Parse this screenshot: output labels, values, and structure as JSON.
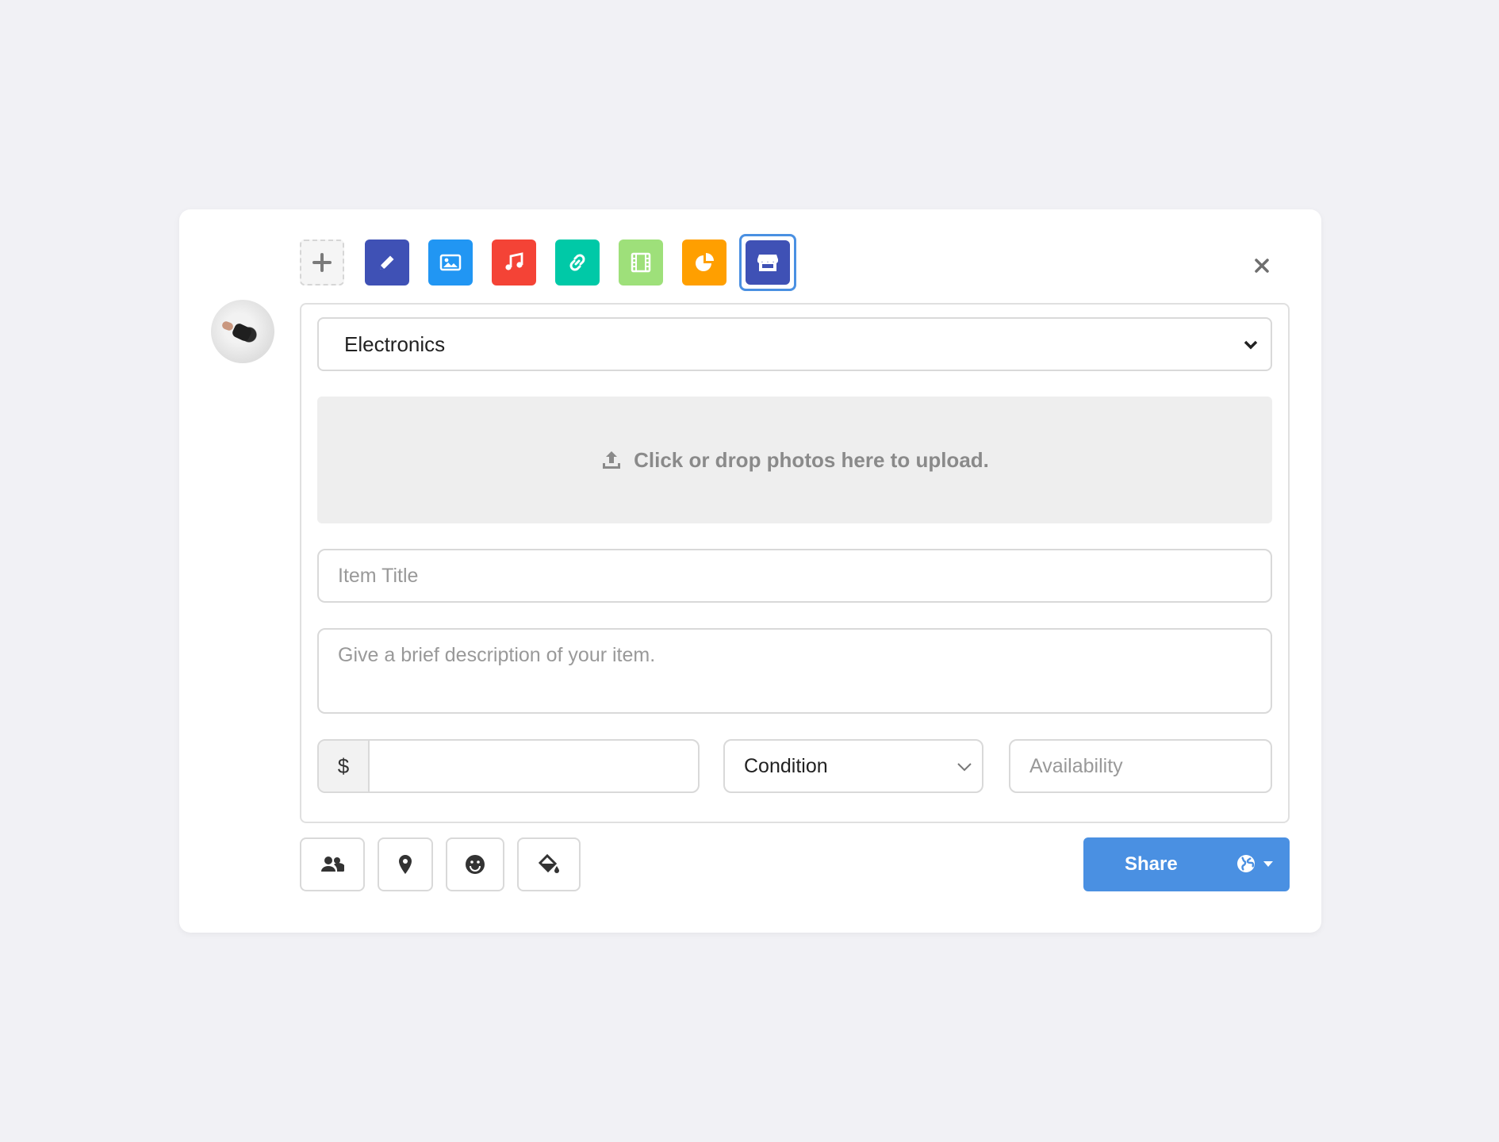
{
  "post_types": [
    {
      "name": "add",
      "color": "#f5f5f5",
      "icon": "plus-icon"
    },
    {
      "name": "text",
      "color": "#3f51b5",
      "icon": "pencil-icon"
    },
    {
      "name": "photo",
      "color": "#2196f3",
      "icon": "image-icon"
    },
    {
      "name": "music",
      "color": "#f44336",
      "icon": "music-note-icon"
    },
    {
      "name": "link",
      "color": "#00c9a7",
      "icon": "link-icon"
    },
    {
      "name": "video",
      "color": "#9ee07a",
      "icon": "film-icon"
    },
    {
      "name": "poll",
      "color": "#ff9f00",
      "icon": "pie-chart-icon"
    },
    {
      "name": "sell",
      "color": "#3f51b5",
      "icon": "store-icon",
      "selected": true
    }
  ],
  "form": {
    "category": "Electronics",
    "upload_text": "Click or drop photos here to upload.",
    "title_placeholder": "Item Title",
    "description_placeholder": "Give a brief description of your item.",
    "currency_symbol": "$",
    "price_value": "",
    "condition_label": "Condition",
    "availability_placeholder": "Availability"
  },
  "toolbar": {
    "icons": [
      "users-icon",
      "location-pin-icon",
      "smile-icon",
      "paint-bucket-icon"
    ]
  },
  "share": {
    "label": "Share",
    "privacy_icon": "globe-icon",
    "accent_color": "#4a90e2"
  }
}
